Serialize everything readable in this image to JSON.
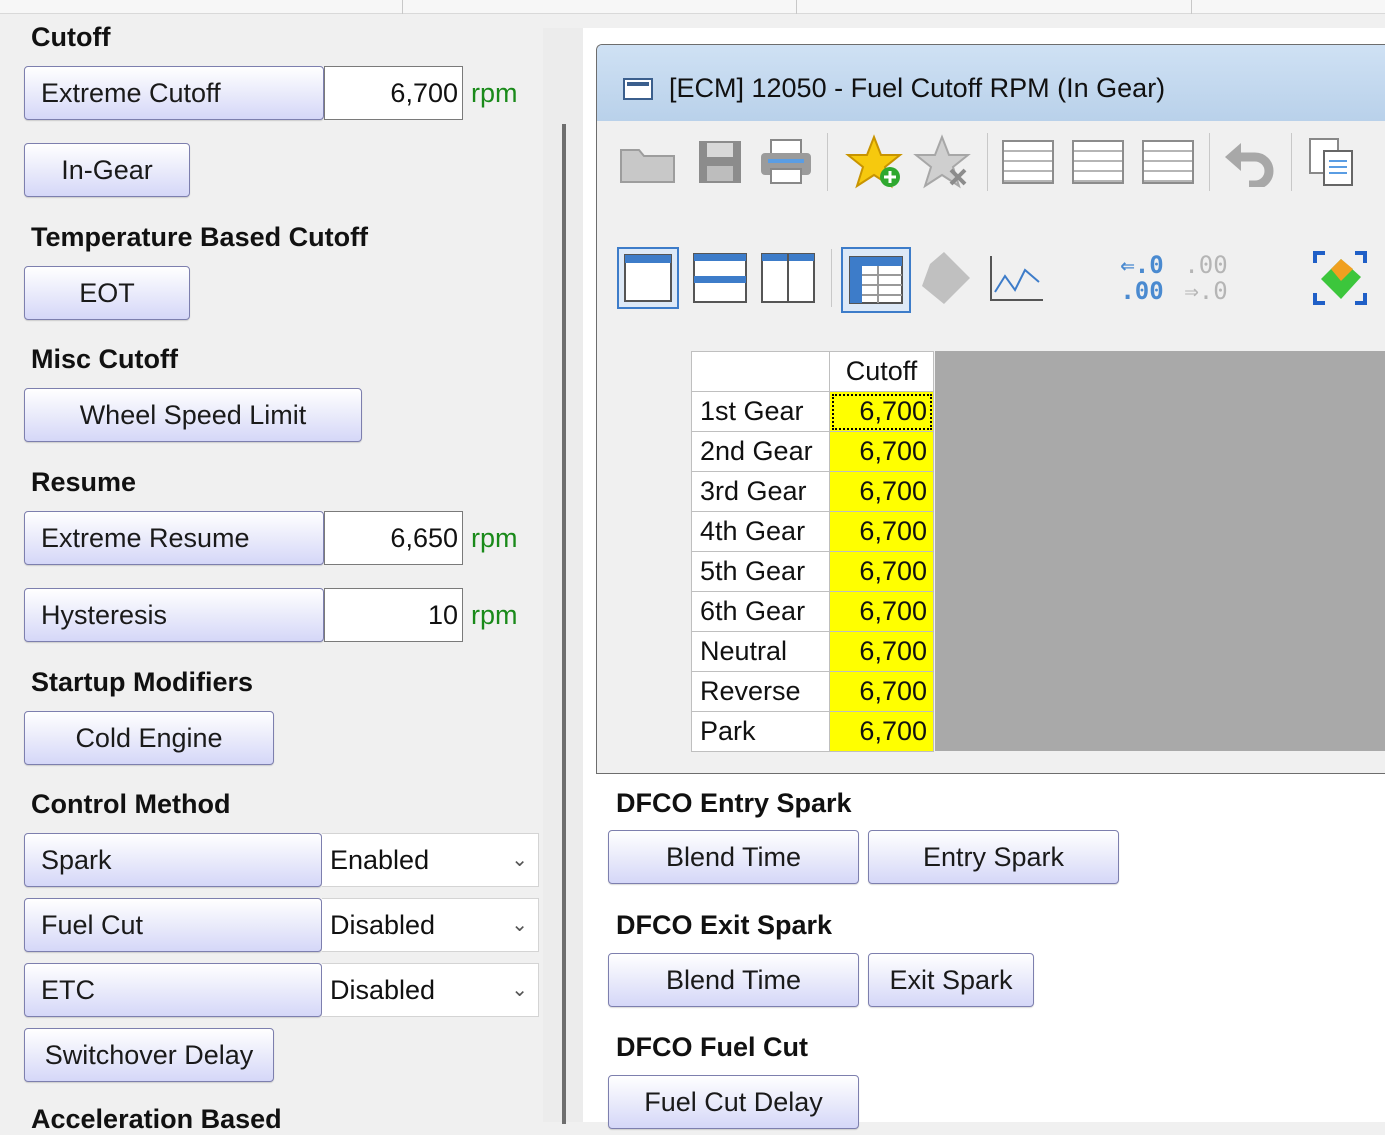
{
  "left": {
    "cutoff": {
      "title": "Cutoff",
      "extreme_label": "Extreme Cutoff",
      "extreme_value": "6,700",
      "extreme_unit": "rpm",
      "in_gear_label": "In-Gear"
    },
    "temperature": {
      "title": "Temperature Based Cutoff",
      "eot_label": "EOT"
    },
    "misc": {
      "title": "Misc Cutoff",
      "wheel_speed_label": "Wheel Speed Limit"
    },
    "resume": {
      "title": "Resume",
      "extreme_label": "Extreme Resume",
      "extreme_value": "6,650",
      "extreme_unit": "rpm",
      "hyst_label": "Hysteresis",
      "hyst_value": "10",
      "hyst_unit": "rpm"
    },
    "startup": {
      "title": "Startup Modifiers",
      "cold_label": "Cold Engine"
    },
    "control": {
      "title": "Control Method",
      "rows": [
        {
          "label": "Spark",
          "value": "Enabled"
        },
        {
          "label": "Fuel Cut",
          "value": "Disabled"
        },
        {
          "label": "ETC",
          "value": "Disabled"
        }
      ],
      "switchover_label": "Switchover Delay"
    },
    "accel": {
      "title": "Acceleration Based"
    }
  },
  "window": {
    "title": "[ECM] 12050 - Fuel Cutoff RPM (In Gear)",
    "table": {
      "column_header": "Cutoff",
      "rows": [
        {
          "label": "1st Gear",
          "value": "6,700"
        },
        {
          "label": "2nd Gear",
          "value": "6,700"
        },
        {
          "label": "3rd Gear",
          "value": "6,700"
        },
        {
          "label": "4th Gear",
          "value": "6,700"
        },
        {
          "label": "5th Gear",
          "value": "6,700"
        },
        {
          "label": "6th Gear",
          "value": "6,700"
        },
        {
          "label": "Neutral",
          "value": "6,700"
        },
        {
          "label": "Reverse",
          "value": "6,700"
        },
        {
          "label": "Park",
          "value": "6,700"
        }
      ]
    },
    "toolbar_icons": [
      "open-folder-icon",
      "save-icon",
      "print-icon",
      "add-favorite-icon",
      "remove-favorite-icon",
      "grid-icon",
      "grid-icon",
      "grid-icon",
      "undo-icon",
      "copy-icon",
      "single-view-icon",
      "split-horizontal-icon",
      "split-vertical-icon",
      "table-view-icon",
      "3d-view-icon",
      "graph-view-icon",
      "increase-decimals-icon",
      "decrease-decimals-icon",
      "color-map-icon"
    ],
    "decimals": {
      "inc_top": "⇐.0",
      "inc_bottom": ".00",
      "dec_top": ".00",
      "dec_bottom": "⇒.0"
    }
  },
  "right": {
    "dfco_entry": {
      "title": "DFCO Entry Spark",
      "blend_label": "Blend Time",
      "spark_label": "Entry Spark"
    },
    "dfco_exit": {
      "title": "DFCO Exit Spark",
      "blend_label": "Blend Time",
      "spark_label": "Exit Spark"
    },
    "dfco_fuel": {
      "title": "DFCO Fuel Cut",
      "delay_label": "Fuel Cut Delay"
    }
  },
  "colors": {
    "cell_yellow": "#ffff00",
    "unit_green": "#1a8a1a",
    "button_top": "#ffffff",
    "button_bottom": "#d5d7f8",
    "selection_blue": "#3d7cc9"
  }
}
